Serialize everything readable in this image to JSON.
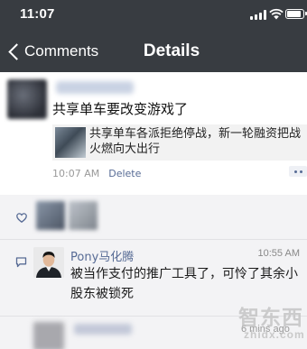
{
  "status_bar": {
    "time": "11:07"
  },
  "nav": {
    "back_label": "Comments",
    "title": "Details"
  },
  "post": {
    "text": "共享单车要改变游戏了",
    "link": {
      "title": "共享单车各派拒绝停战，新一轮融资把战火燃向大出行"
    },
    "time": "10:07 AM",
    "delete_label": "Delete"
  },
  "comments": [
    {
      "name": "Pony马化腾",
      "time": "10:55 AM",
      "text": "被当作支付的推广工具了，可怜了其余小股东被锁死"
    },
    {
      "time": "6 mins ago"
    }
  ],
  "watermark": {
    "cn": "智东西",
    "en": "zhidx.com"
  },
  "colors": {
    "nav_bg": "#383c41",
    "link_name": "#576b95",
    "panel_bg": "#f3f3f5"
  }
}
